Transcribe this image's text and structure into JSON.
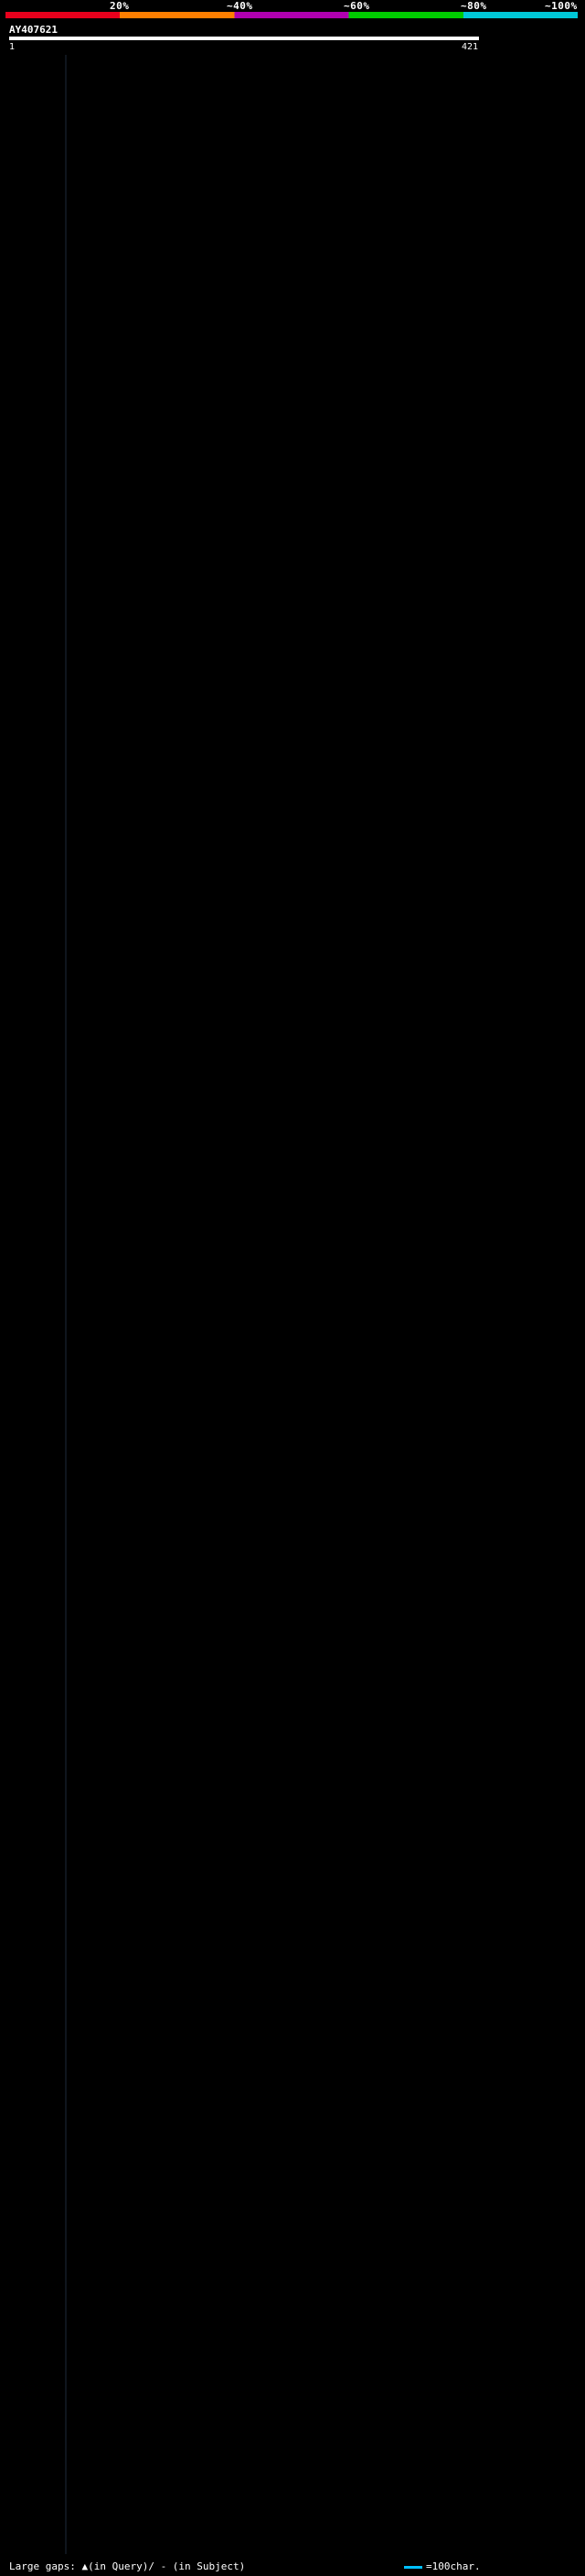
{
  "identity_scale": {
    "labels": [
      "20%",
      "~40%",
      "~60%",
      "~80%",
      "~100%"
    ],
    "colors": [
      "#e8001c",
      "#ff7f00",
      "#b000b0",
      "#00cc00",
      "#00c8d8"
    ]
  },
  "query": {
    "id": "AY407621",
    "ruler_start": "1",
    "ruler_end": "421",
    "length": 421
  },
  "legend": {
    "large_gaps": "Large gaps: ▲(in Query)/ - (in Subject)",
    "scale": "=100char."
  },
  "chart_data": {
    "type": "alignment",
    "x_axis": {
      "min": 1,
      "max": 421,
      "unit": "char"
    },
    "hits": []
  }
}
